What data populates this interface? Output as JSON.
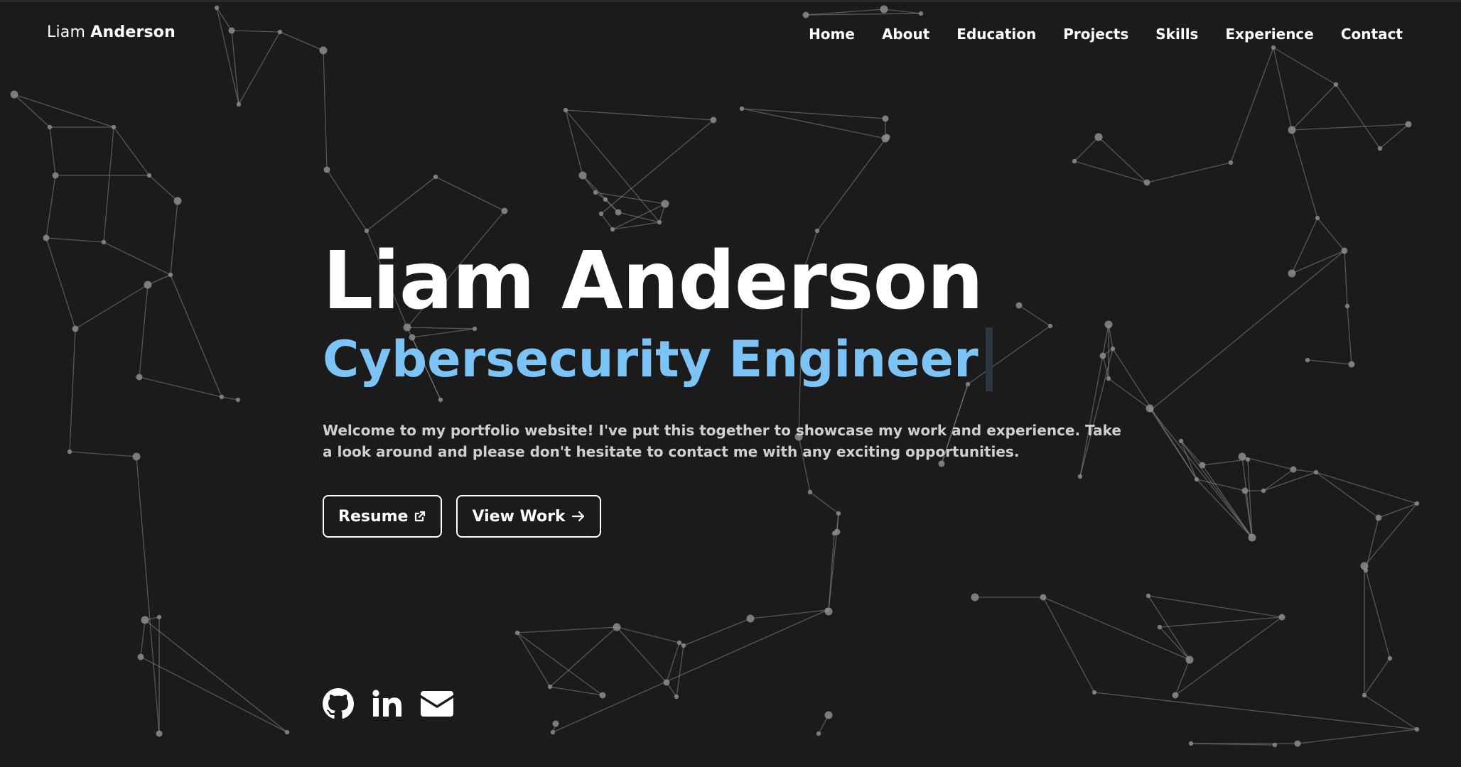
{
  "brand": {
    "first": "Liam",
    "last": "Anderson"
  },
  "nav": {
    "items": [
      {
        "label": "Home"
      },
      {
        "label": "About"
      },
      {
        "label": "Education"
      },
      {
        "label": "Projects"
      },
      {
        "label": "Skills"
      },
      {
        "label": "Experience"
      },
      {
        "label": "Contact"
      }
    ]
  },
  "hero": {
    "name": "Liam Anderson",
    "role": "Cybersecurity Engineer",
    "intro": "Welcome to my portfolio website! I've put this together to showcase my work and experience. Take a look around and please don't hesitate to contact me with any exciting opportunities.",
    "resume_label": "Resume",
    "resume_icon": "external-link-icon",
    "view_work_label": "View Work",
    "view_work_icon": "arrow-right-icon",
    "role_color": "#7cc4f5"
  },
  "socials": [
    {
      "icon": "github-icon"
    },
    {
      "icon": "linkedin-icon"
    },
    {
      "icon": "envelope-icon"
    }
  ],
  "colors": {
    "background": "#1b1b1c",
    "text": "#ffffff",
    "accent": "#7cc4f5",
    "network": "#8c8c8c"
  }
}
